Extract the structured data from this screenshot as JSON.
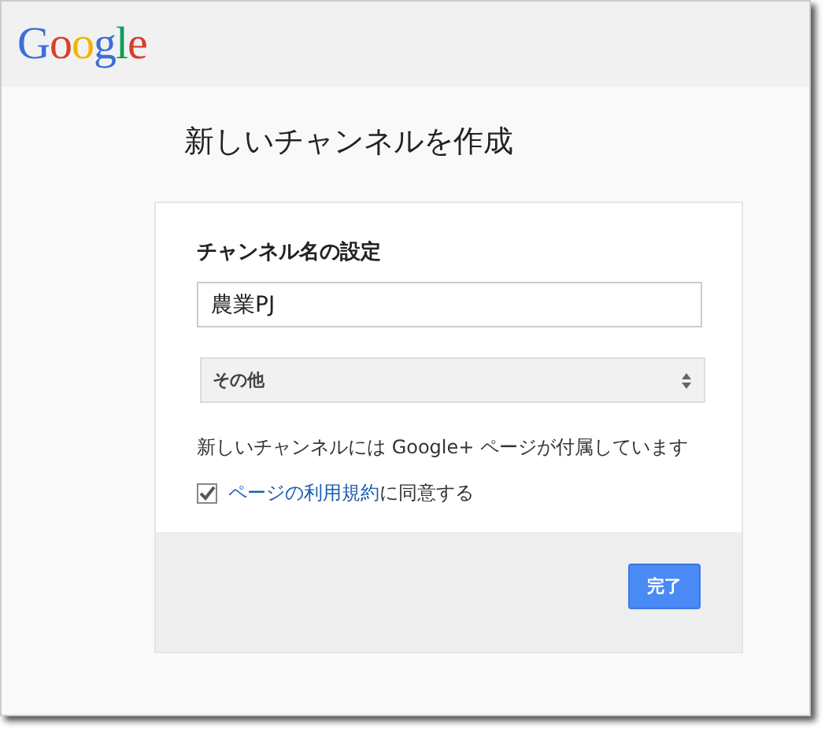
{
  "header": {
    "logo": "Google"
  },
  "title": "新しいチャンネルを作成",
  "form": {
    "heading": "チャンネル名の設定",
    "name_field": {
      "value": "農業PJ"
    },
    "category_select": {
      "value": "その他"
    },
    "notice": "新しいチャンネルには Google+ ページが付属しています",
    "agree": {
      "checked": true,
      "link": "ページの利用規約",
      "text": "に同意する"
    },
    "submit": "完了"
  }
}
